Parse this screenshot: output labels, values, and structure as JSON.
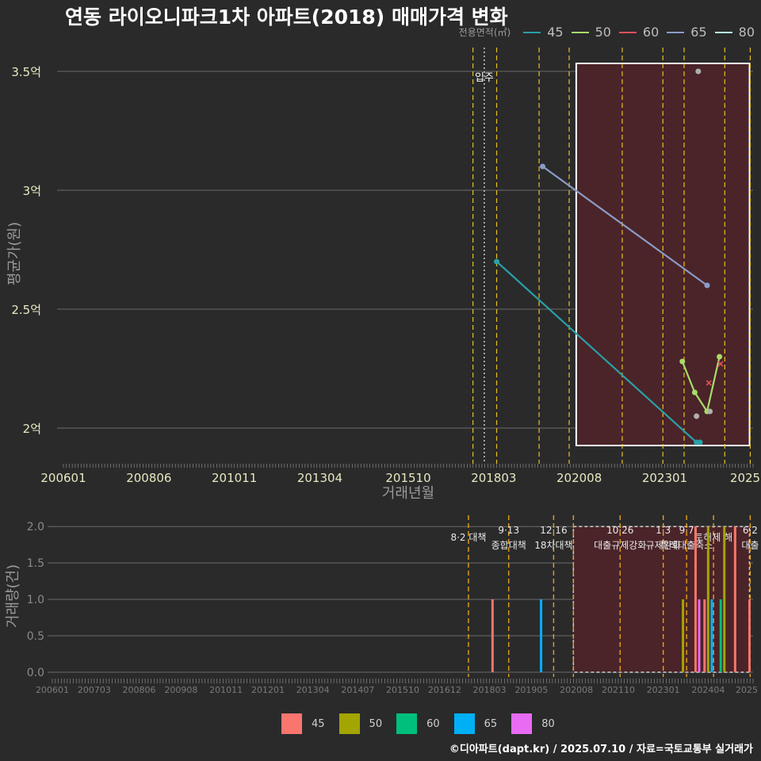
{
  "title": "연동 라이오니파크1차 아파트(2018) 매매가격 변화",
  "caption": "©디아파트(dapt.kr) / 2025.07.10 / 자료=국토교통부 실거래가",
  "legend_top": {
    "title": "전용면적(㎡)",
    "items": [
      {
        "label": "45",
        "color": "#2aa0a8"
      },
      {
        "label": "50",
        "color": "#a8dc6a"
      },
      {
        "label": "60",
        "color": "#e0505a"
      },
      {
        "label": "65",
        "color": "#8c9cc8"
      },
      {
        "label": "80",
        "color": "#b8f0f4"
      }
    ]
  },
  "legend_bottom": {
    "items": [
      {
        "label": "45",
        "color": "#f8766d"
      },
      {
        "label": "50",
        "color": "#a3a500"
      },
      {
        "label": "60",
        "color": "#00bf7d"
      },
      {
        "label": "65",
        "color": "#00b0f6"
      },
      {
        "label": "80",
        "color": "#e76bf3"
      }
    ]
  },
  "chart_data": [
    {
      "type": "line",
      "title": "연동 라이오니파크1차 아파트(2018) 매매가격 변화",
      "xlabel": "거래년월",
      "ylabel": "평균가(원)",
      "x_ticks": [
        "200601",
        "200806",
        "201011",
        "201304",
        "201510",
        "201803",
        "202008",
        "202301",
        "2025"
      ],
      "y_ticks": [
        "2억",
        "2.5억",
        "3억",
        "3.5억"
      ],
      "ylim": [
        1.85,
        3.65
      ],
      "grid": true,
      "annotation": "입주",
      "series": [
        {
          "name": "45",
          "points": [
            {
              "x": "2018.25",
              "y": 2.7
            },
            {
              "x": "2023.90",
              "y": 1.94
            },
            {
              "x": "2024.00",
              "y": 1.94
            }
          ]
        },
        {
          "name": "50",
          "points": [
            {
              "x": "2023.50",
              "y": 2.28
            },
            {
              "x": "2023.85",
              "y": 2.15
            },
            {
              "x": "2024.20",
              "y": 2.07
            },
            {
              "x": "2024.55",
              "y": 2.3
            }
          ]
        },
        {
          "name": "60",
          "points": [
            {
              "x": "2024.25",
              "y": 2.19
            },
            {
              "x": "2024.58",
              "y": 2.27
            }
          ]
        },
        {
          "name": "65",
          "points": [
            {
              "x": "2019.55",
              "y": 3.1
            },
            {
              "x": "2024.20",
              "y": 2.6
            }
          ]
        },
        {
          "name": "80",
          "points": []
        }
      ],
      "extra_points": [
        {
          "x": "2023.95",
          "y": 3.5
        },
        {
          "x": "2023.90",
          "y": 2.05
        },
        {
          "x": "2024.28",
          "y": 2.07
        }
      ],
      "policy_lines": [
        "2017.58",
        "2018.25",
        "2019.45",
        "2020.30",
        "2021.80",
        "2022.95",
        "2023.55",
        "2024.70",
        "2025.42"
      ],
      "occupancy_x": "2017.90",
      "highlight_range": [
        "2020.50",
        "2025.40"
      ]
    },
    {
      "type": "bar",
      "ylabel": "거래량(건)",
      "x_ticks": [
        "200601",
        "200703",
        "200806",
        "200908",
        "201011",
        "201201",
        "201304",
        "201407",
        "201510",
        "201612",
        "201803",
        "201905",
        "202008",
        "202110",
        "202301",
        "202404",
        "2025"
      ],
      "y_ticks": [
        "0.0",
        "0.5",
        "1.0",
        "1.5",
        "2.0"
      ],
      "ylim": [
        0,
        2.1
      ],
      "grid": true,
      "bars": [
        {
          "x": "2018.25",
          "value": 1,
          "series": "45"
        },
        {
          "x": "2019.60",
          "value": 1,
          "series": "65"
        },
        {
          "x": "2023.55",
          "value": 1,
          "series": "50"
        },
        {
          "x": "2023.90",
          "value": 2,
          "series": "45"
        },
        {
          "x": "2024.00",
          "value": 1,
          "series": "80"
        },
        {
          "x": "2024.15",
          "value": 1,
          "series": "45"
        },
        {
          "x": "2024.25",
          "value": 2,
          "series": "50"
        },
        {
          "x": "2024.35",
          "value": 1,
          "series": "65"
        },
        {
          "x": "2024.60",
          "value": 1,
          "series": "60"
        },
        {
          "x": "2024.70",
          "value": 2,
          "series": "50"
        },
        {
          "x": "2025.00",
          "value": 2,
          "series": "45"
        },
        {
          "x": "2025.40",
          "value": 1,
          "series": "45"
        }
      ],
      "policies": [
        {
          "x": "2017.58",
          "date": "",
          "label": "8·2 대책"
        },
        {
          "x": "2018.70",
          "date": "9·13",
          "label": "종합대책"
        },
        {
          "x": "2019.95",
          "date": "12·16",
          "label": "18차대책"
        },
        {
          "x": "2020.50",
          "date": "",
          "label": ""
        },
        {
          "x": "2021.80",
          "date": "10·26",
          "label": "대출규제강화"
        },
        {
          "x": "2023.00",
          "date": "1·3",
          "label": "규제완화"
        },
        {
          "x": "2023.65",
          "date": "9·7",
          "label": "특례대출축소"
        },
        {
          "x": "2024.40",
          "date": "",
          "label": "토허제 해"
        },
        {
          "x": "2025.42",
          "date": "6·2",
          "label": "대출"
        }
      ],
      "highlight_range": [
        "2020.50",
        "2025.40"
      ]
    }
  ]
}
